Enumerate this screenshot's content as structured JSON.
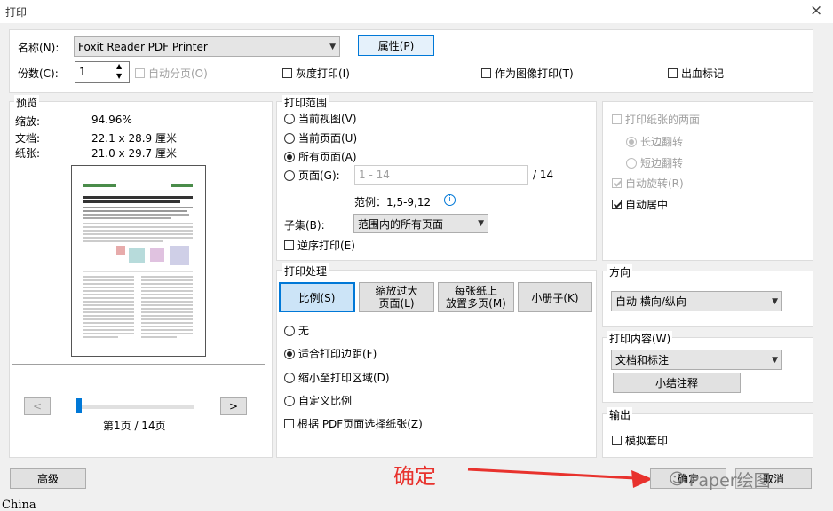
{
  "window": {
    "title": "打印",
    "close": "×"
  },
  "printer": {
    "name_label": "名称(N):",
    "name_value": "Foxit Reader PDF Printer",
    "properties_label": "属性(P)",
    "copies_label": "份数(C):",
    "copies_value": "1",
    "collate_label": "自动分页(O)",
    "grayscale_label": "灰度打印(I)",
    "as_image_label": "作为图像打印(T)",
    "bleed_label": "出血标记"
  },
  "preview": {
    "legend": "预览",
    "zoom_label": "缩放:",
    "zoom_value": "94.96%",
    "doc_label": "文档:",
    "doc_value": "22.1 x 28.9 厘米",
    "paper_label": "纸张:",
    "paper_value": "21.0 x 29.7 厘米",
    "prev": "<",
    "next": ">",
    "page_info": "第1页 / 14页",
    "slider_position": 0.0
  },
  "range": {
    "legend": "打印范围",
    "current_view": "当前视图(V)",
    "current_page": "当前页面(U)",
    "all_pages": "所有页面(A)",
    "pages": "页面(G):",
    "pages_placeholder": "1 - 14",
    "pages_total": "/ 14",
    "example": "范例：1,5-9,12",
    "info_icon": "i",
    "subset_label": "子集(B):",
    "subset_value": "范围内的所有页面",
    "reverse": "逆序打印(E)"
  },
  "handling": {
    "legend": "打印处理",
    "scale": "比例(S)",
    "shrink_line1": "缩放过大",
    "shrink_line2": "页面(L)",
    "multiple_line1": "每张纸上",
    "multiple_line2": "放置多页(M)",
    "booklet": "小册子(K)",
    "none": "无",
    "fit_margins": "适合打印边距(F)",
    "shrink_area": "缩小至打印区域(D)",
    "custom": "自定义比例",
    "choose_paper": "根据 PDF页面选择纸张(Z)"
  },
  "duplex": {
    "both_sides": "打印纸张的两面",
    "long_edge": "长边翻转",
    "short_edge": "短边翻转",
    "auto_rotate": "自动旋转(R)",
    "auto_center": "自动居中"
  },
  "orientation": {
    "legend": "方向",
    "value": "自动 横向/纵向"
  },
  "content": {
    "legend": "打印内容(W)",
    "value": "文档和标注",
    "summarize": "小结注释"
  },
  "output": {
    "legend": "输出",
    "simulate": "模拟套印"
  },
  "footer": {
    "advanced": "高级",
    "ok": "确定",
    "cancel": "取消",
    "annotation": "确定",
    "watermark": "Paper绘图",
    "bottom_text": "China"
  },
  "colors": {
    "accent": "#0078d7",
    "annotation_red": "#e8322d"
  }
}
